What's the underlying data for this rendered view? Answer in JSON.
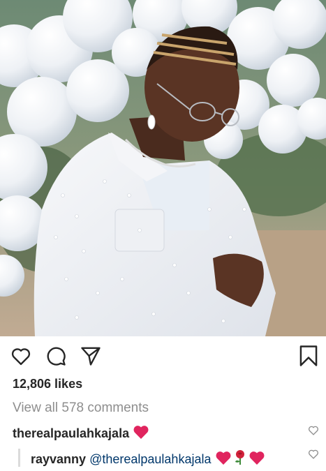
{
  "post": {
    "image_alt": "Man in white embellished jacket in front of white balloons"
  },
  "actions": {
    "like_icon": "heart-outline-icon",
    "comment_icon": "comment-bubble-icon",
    "share_icon": "paper-plane-icon",
    "save_icon": "bookmark-icon"
  },
  "likes": "12,806 likes",
  "view_comments": "View all 578 comments",
  "comments": [
    {
      "user": "therealpaulahkajala",
      "emojis": [
        "red-heart"
      ]
    }
  ],
  "replies": [
    {
      "user": "rayvanny",
      "mention": "@therealpaulahkajala",
      "emojis": [
        "red-heart",
        "rose",
        "red-heart"
      ]
    }
  ],
  "colors": {
    "text": "#262626",
    "muted": "#8e8e8e",
    "mention": "#00376b",
    "heart": "#e0245e"
  }
}
